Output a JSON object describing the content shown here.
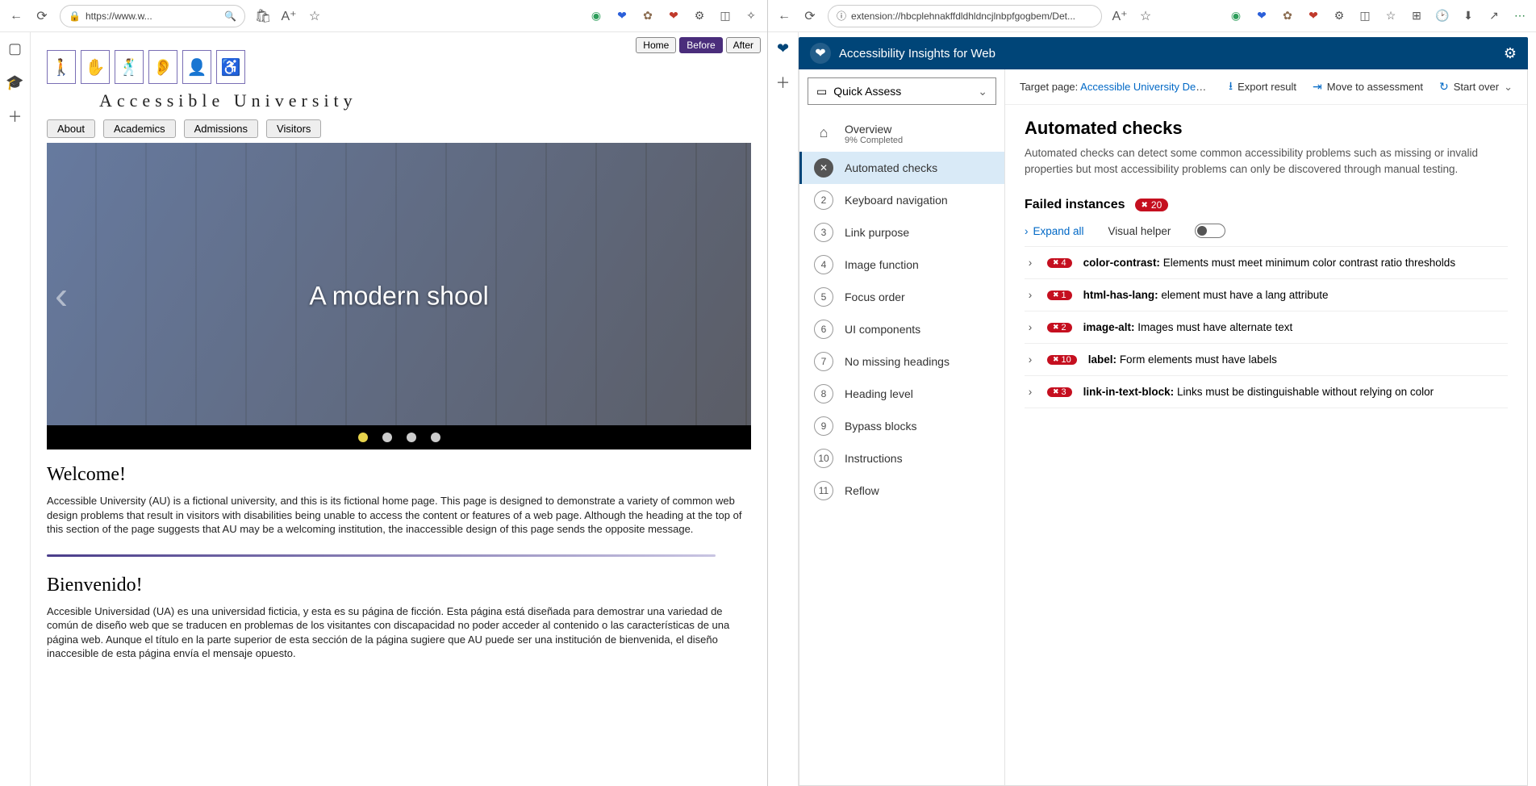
{
  "left": {
    "chrome": {
      "url": "https://www.w..."
    },
    "demo_tabs": {
      "home": "Home",
      "before": "Before",
      "after": "After"
    },
    "logo": {
      "text": "Accessible University"
    },
    "nav": [
      "About",
      "Academics",
      "Admissions",
      "Visitors"
    ],
    "hero": {
      "caption": "A modern shool"
    },
    "sections": {
      "welcome_h": "Welcome!",
      "welcome_p": "Accessible University (AU) is a fictional university, and this is its fictional home page. This page is designed to demonstrate a variety of common web design problems that result in visitors with disabilities being unable to access the content or features of a web page. Although the heading at the top of this section of the page suggests that AU may be a welcoming institution, the inaccessible design of this page sends the opposite message.",
      "bienv_h": "Bienvenido!",
      "bienv_p": "Accesible Universidad (UA) es una universidad ficticia, y esta es su página de ficción. Esta página está diseñada para demostrar una variedad de común de diseño web que se traducen en problemas de los visitantes con discapacidad no poder acceder al contenido o las características de una página web. Aunque el título en la parte superior de esta sección de la página sugiere que AU puede ser una institución de bienvenida, el diseño inaccesible de esta página envía el mensaje opuesto."
    }
  },
  "right": {
    "chrome": {
      "url": "extension://hbcplehnakffdldhldncjlnbpfgogbem/Det..."
    },
    "header": {
      "title": "Accessibility Insights for Web"
    },
    "quick_assess": "Quick Assess",
    "overview": {
      "label": "Overview",
      "sub": "9% Completed"
    },
    "steps": [
      {
        "n": "✕",
        "label": "Automated checks",
        "active": true
      },
      {
        "n": "2",
        "label": "Keyboard navigation"
      },
      {
        "n": "3",
        "label": "Link purpose"
      },
      {
        "n": "4",
        "label": "Image function"
      },
      {
        "n": "5",
        "label": "Focus order"
      },
      {
        "n": "6",
        "label": "UI components"
      },
      {
        "n": "7",
        "label": "No missing headings"
      },
      {
        "n": "8",
        "label": "Heading level"
      },
      {
        "n": "9",
        "label": "Bypass blocks"
      },
      {
        "n": "10",
        "label": "Instructions"
      },
      {
        "n": "11",
        "label": "Reflow"
      }
    ],
    "toolbar": {
      "target_prefix": "Target page: ",
      "target_link": "Accessible University Demo Site - Inaccessi...",
      "export": "Export result",
      "move": "Move to assessment",
      "start_over": "Start over"
    },
    "content": {
      "title": "Automated checks",
      "desc": "Automated checks can detect some common accessibility problems such as missing or invalid properties but most accessibility problems can only be discovered through manual testing.",
      "failed_label": "Failed instances",
      "failed_count": "20",
      "expand": "Expand all",
      "visual_helper": "Visual helper",
      "rules": [
        {
          "count": "4",
          "id": "color-contrast",
          "msg": "Elements must meet minimum color contrast ratio thresholds"
        },
        {
          "count": "1",
          "id": "html-has-lang",
          "msg": "<html> element must have a lang attribute"
        },
        {
          "count": "2",
          "id": "image-alt",
          "msg": "Images must have alternate text"
        },
        {
          "count": "10",
          "id": "label",
          "msg": "Form elements must have labels"
        },
        {
          "count": "3",
          "id": "link-in-text-block",
          "msg": "Links must be distinguishable without relying on color"
        }
      ]
    }
  }
}
